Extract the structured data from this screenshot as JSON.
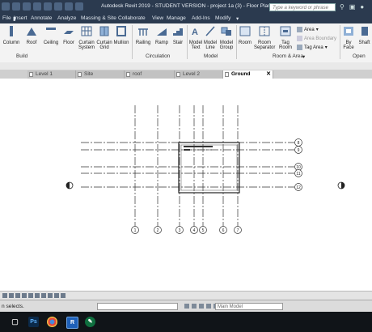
{
  "window": {
    "title": "Autodesk Revit 2019 - STUDENT VERSION - project 1a (3) - Floor Plan: Ground",
    "search_placeholder": "Type a keyword or phrase"
  },
  "menu_tabs": [
    "File",
    "Insert",
    "Annotate",
    "Analyze",
    "Massing & Site",
    "Collaborate",
    "View",
    "Manage",
    "Add-Ins",
    "Modify"
  ],
  "ribbon": {
    "build": {
      "label": "Build",
      "column": "Column",
      "roof": "Roof",
      "ceiling": "Ceiling",
      "floor": "Floor",
      "curtain_system_1": "Curtain",
      "curtain_system_2": "System",
      "curtain_grid_1": "Curtain",
      "curtain_grid_2": "Grid",
      "mullion": "Mullion"
    },
    "circulation": {
      "label": "Circulation",
      "railing": "Railing",
      "ramp": "Ramp",
      "stair": "Stair"
    },
    "model": {
      "label": "Model",
      "model_text_1": "Model",
      "model_text_2": "Text",
      "model_line_1": "Model",
      "model_line_2": "Line",
      "model_group_1": "Model",
      "model_group_2": "Group"
    },
    "room_area": {
      "label": "Room & Area",
      "room": "Room",
      "room_separator_1": "Room",
      "room_separator_2": "Separator",
      "tag_room_1": "Tag",
      "tag_room_2": "Room",
      "area": "Area",
      "area_boundary": "Area  Boundary",
      "tag_area": "Tag  Area"
    },
    "opening": {
      "label": "Open",
      "by_face_1": "By",
      "by_face_2": "Face",
      "shaft": "Shaft"
    }
  },
  "view_tabs": [
    {
      "label": "Level 1",
      "active": false
    },
    {
      "label": "Site",
      "active": false
    },
    {
      "label": "roof",
      "active": false
    },
    {
      "label": "Level 2",
      "active": false
    },
    {
      "label": "Ground",
      "active": true
    }
  ],
  "grids": {
    "vertical": [
      "1",
      "2",
      "3",
      "4",
      "5",
      "6",
      "7"
    ],
    "horizontal": [
      "8",
      "9",
      "10",
      "11",
      "12"
    ]
  },
  "status": {
    "message": "n selects.",
    "workset": "Main Model"
  },
  "taskbar": [
    "Photoshop",
    "Chrome",
    "Revit",
    "App"
  ]
}
